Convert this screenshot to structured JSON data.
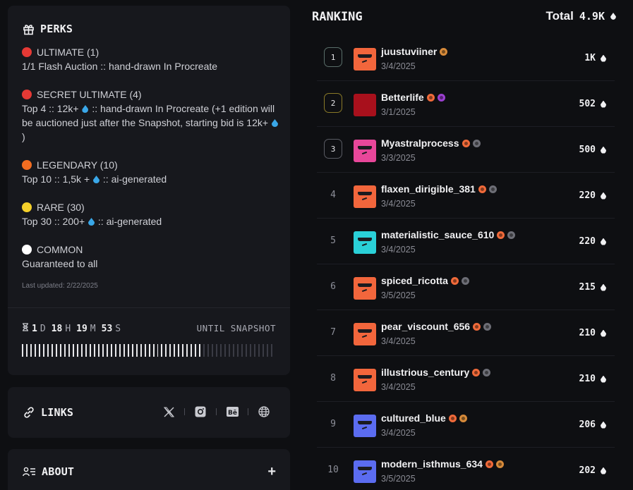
{
  "perks": {
    "title": "PERKS",
    "items": [
      {
        "name": "ULTIMATE (1)",
        "color": "#e53935",
        "desc": "1/1 Flash Auction :: hand-drawn In Procreate"
      },
      {
        "name": "SECRET ULTIMATE (4)",
        "color": "#e53935",
        "desc_a": "Top 4 :: 12k+",
        "desc_b": " :: hand-drawn In Procreate (+1 edition will be auctioned just after the Snapshot, starting bid is 12k+",
        "desc_c": ")"
      },
      {
        "name": "LEGENDARY (10)",
        "color": "#f26d21",
        "desc_a": "Top 10 :: 1,5k +",
        "desc_b": " :: ai-generated"
      },
      {
        "name": "RARE (30)",
        "color": "#f5d02a",
        "desc_a": "Top 30 :: 200+",
        "desc_b": " :: ai-generated"
      },
      {
        "name": "COMMON",
        "color": "#ffffff",
        "desc": "Guaranteed to all"
      }
    ],
    "updated": "Last updated: 2/22/2025"
  },
  "countdown": {
    "days": "1",
    "days_unit": "D",
    "hours": "18",
    "hours_unit": "H",
    "minutes": "19",
    "minutes_unit": "M",
    "seconds": "53",
    "seconds_unit": "S",
    "label": "UNTIL SNAPSHOT",
    "progress": 0.72
  },
  "links": {
    "title": "LINKS",
    "icons": [
      "x-icon",
      "instagram-icon",
      "behance-icon",
      "globe-icon"
    ]
  },
  "about": {
    "title": "ABOUT",
    "toggle": "+"
  },
  "ranking": {
    "title": "RANKING",
    "total_label": "Total",
    "total_value": "4.9K",
    "rows": [
      {
        "rank": "1",
        "name": "juustuviiner",
        "date": "3/4/2025",
        "score": "1K",
        "avatar": "#f2663c",
        "badges": [
          "#d68a3a"
        ],
        "medal": "#5a6f6a"
      },
      {
        "rank": "2",
        "name": "Betterlife",
        "date": "3/1/2025",
        "score": "502",
        "avatar": "#a8101c",
        "badges": [
          "#f06a3a",
          "#9b3fd0"
        ],
        "medal": "#8a7a28"
      },
      {
        "rank": "3",
        "name": "Myastralprocess",
        "date": "3/3/2025",
        "score": "500",
        "avatar": "#e8479a",
        "badges": [
          "#f06a3a",
          "#6d6e76"
        ],
        "medal": "#5a5c64"
      },
      {
        "rank": "4",
        "name": "flaxen_dirigible_381",
        "date": "3/4/2025",
        "score": "220",
        "avatar": "#f2663c",
        "badges": [
          "#f06a3a",
          "#6d6e76"
        ]
      },
      {
        "rank": "5",
        "name": "materialistic_sauce_610",
        "date": "3/4/2025",
        "score": "220",
        "avatar": "#2ad0d8",
        "badges": [
          "#f06a3a",
          "#6d6e76"
        ]
      },
      {
        "rank": "6",
        "name": "spiced_ricotta",
        "date": "3/5/2025",
        "score": "215",
        "avatar": "#f2663c",
        "badges": [
          "#f06a3a",
          "#6d6e76"
        ]
      },
      {
        "rank": "7",
        "name": "pear_viscount_656",
        "date": "3/4/2025",
        "score": "210",
        "avatar": "#f2663c",
        "badges": [
          "#f06a3a",
          "#6d6e76"
        ]
      },
      {
        "rank": "8",
        "name": "illustrious_century",
        "date": "3/4/2025",
        "score": "210",
        "avatar": "#f2663c",
        "badges": [
          "#f06a3a",
          "#6d6e76"
        ]
      },
      {
        "rank": "9",
        "name": "cultured_blue",
        "date": "3/4/2025",
        "score": "206",
        "avatar": "#5b6cf0",
        "badges": [
          "#f06a3a",
          "#d68a3a"
        ]
      },
      {
        "rank": "10",
        "name": "modern_isthmus_634",
        "date": "3/5/2025",
        "score": "202",
        "avatar": "#5b6cf0",
        "badges": [
          "#f06a3a",
          "#d68a3a"
        ]
      }
    ]
  }
}
